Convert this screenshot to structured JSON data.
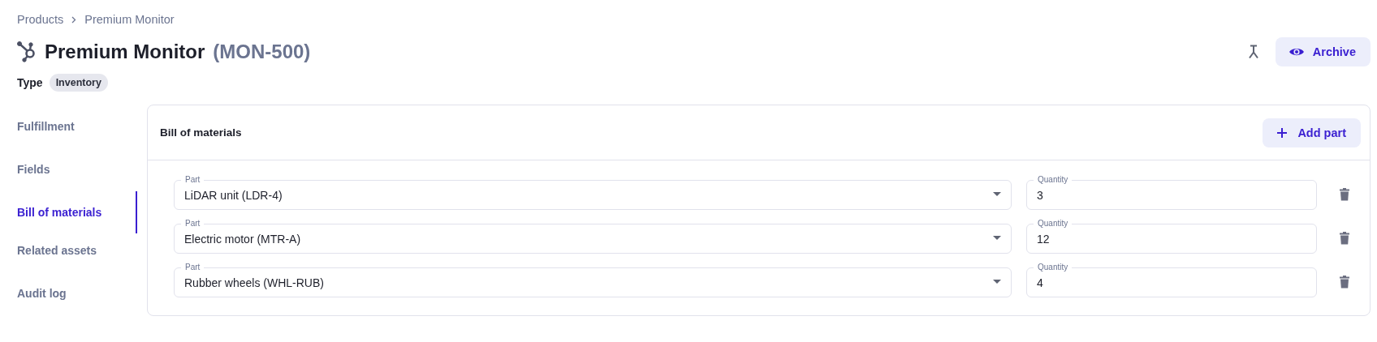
{
  "breadcrumb": [
    "Products",
    "Premium Monitor"
  ],
  "title": {
    "name": "Premium Monitor",
    "code": "(MON-500)"
  },
  "actions": {
    "archive": "Archive"
  },
  "type": {
    "label": "Type",
    "value": "Inventory"
  },
  "sidebar": {
    "items": [
      {
        "label": "Fulfillment",
        "selected": false
      },
      {
        "label": "Fields",
        "selected": false
      },
      {
        "label": "Bill of materials",
        "selected": true
      },
      {
        "label": "Related assets",
        "selected": false
      },
      {
        "label": "Audit log",
        "selected": false
      }
    ]
  },
  "panel": {
    "title": "Bill of materials",
    "add_button": "Add part",
    "rows": [
      {
        "part_label": "Part",
        "part": "LiDAR unit (LDR-4)",
        "quantity_label": "Quantity",
        "quantity": "3"
      },
      {
        "part_label": "Part",
        "part": "Electric motor (MTR-A)",
        "quantity_label": "Quantity",
        "quantity": "12"
      },
      {
        "part_label": "Part",
        "part": "Rubber wheels (WHL-RUB)",
        "quantity_label": "Quantity",
        "quantity": "4"
      }
    ]
  }
}
